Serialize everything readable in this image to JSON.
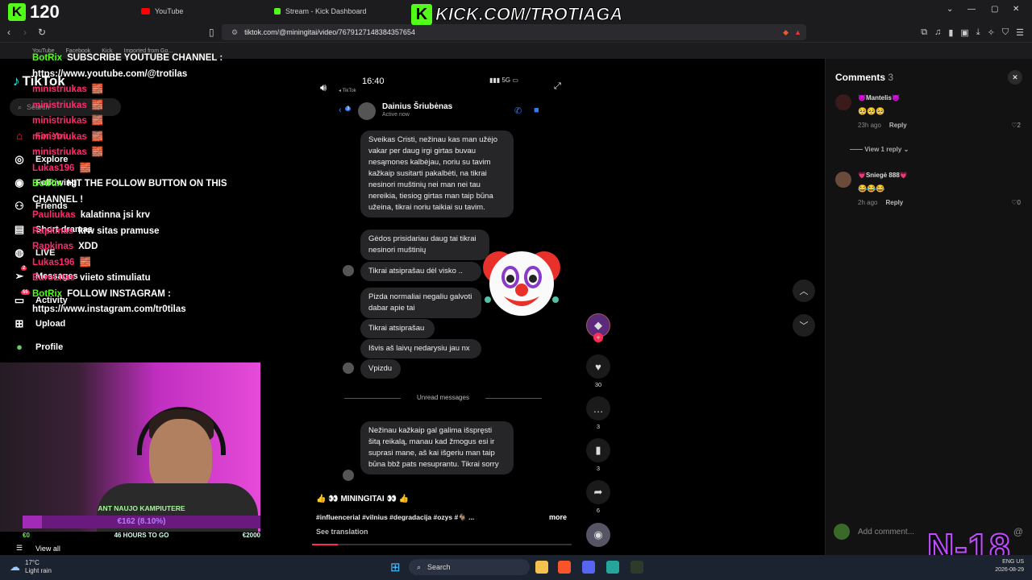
{
  "browser": {
    "tabs": [
      {
        "label": "YouTube",
        "color": "#ff0000"
      },
      {
        "label": "Stream - Kick Dashboard",
        "color": "#53fc18"
      }
    ],
    "url": "tiktok.com/@miningitai/video/7679127148384357654",
    "bookmarks": [
      "YouTube",
      "Facebook",
      "Kick",
      "Imported from Go..."
    ]
  },
  "tiktok": {
    "logo": "TikTok",
    "search_placeholder": "Search",
    "nav": [
      {
        "label": "For You",
        "icon": "home-icon"
      },
      {
        "label": "Explore",
        "icon": "compass-icon"
      },
      {
        "label": "Following",
        "icon": "following-icon"
      },
      {
        "label": "Friends",
        "icon": "friends-icon"
      },
      {
        "label": "Short dramas",
        "icon": "film-icon"
      },
      {
        "label": "LIVE",
        "icon": "live-icon"
      },
      {
        "label": "Messages",
        "icon": "send-icon",
        "badge": "2"
      },
      {
        "label": "Activity",
        "icon": "inbox-icon",
        "badge": "55"
      },
      {
        "label": "Upload",
        "icon": "plus-square-icon"
      },
      {
        "label": "Profile",
        "icon": "profile-icon"
      }
    ],
    "view_all": "View all"
  },
  "video": {
    "phone_time": "16:40",
    "phone_back": "◂ TikTok",
    "phone_status": "5G",
    "chat_contact": "Dainius Šriubėnas",
    "chat_status": "Active now",
    "back_count": "3",
    "messages": [
      "Sveikas Cristi, nežinau kas man užėjo vakar per daug irgi girtas buvau nesąmones kalbėjau, noriu su tavim kažkaip susitarti pakalbėti, na tikrai nesinori muštinių nei man nei tau nereikia, tiesiog girtas man taip būna užeina, tikrai noriu taikiai su tavim.",
      "Gėdos prisidariau daug tai tikrai nesinori muštinių",
      "Tikrai atsiprašau dėl visko ..",
      "Pizda normaliai negaliu galvoti dabar apie tai",
      "Tikrai atsiprašau",
      "Išvis aš laivų nedarysiu jau nx",
      "Vpizdu",
      "Nežinau kažkaip gal galima išspręsti šitą reikalą, manau kad žmogus esi ir suprasi mane, aš kai išgeriu man taip būna bbž pats nesuprantu. Tikrai sorry"
    ],
    "unread_label": "Unread messages",
    "caption_user": "👍 👀 MININGITAI 👀 👍",
    "caption_tags": "#influencerial #vilnius #degradacija #ozys #🐐 ...",
    "more": "more",
    "see_translation": "See translation",
    "progress": 0.1
  },
  "actions": {
    "likes": "30",
    "comments": "3",
    "saves": "3",
    "shares": "6"
  },
  "comments_panel": {
    "title": "Comments",
    "count": "3",
    "items": [
      {
        "name": "😈Mantelis😈",
        "emoji": "🥺🥺🥺",
        "time": "23h ago",
        "reply": "Reply",
        "likes": "2"
      },
      {
        "name": "💗Sniegė 888💗",
        "emoji": "😂😂😂",
        "time": "2h ago",
        "reply": "Reply",
        "likes": "0"
      }
    ],
    "view_replies": "View 1 reply",
    "add_comment": "Add comment..."
  },
  "stream_overlay": {
    "viewer_count": "120",
    "kick_url": "KICK.COM/TROTIAGA",
    "chat": [
      {
        "user": "BotRix",
        "color": "#53fc18",
        "text": "SUBSCRIBE YOUTUBE CHANNEL : https://www.youtube.com/@trotilas"
      },
      {
        "user": "ministriukas",
        "color": "#ff2a6d",
        "text": "🧱"
      },
      {
        "user": "ministriukas",
        "color": "#ff2a6d",
        "text": "🧱"
      },
      {
        "user": "ministriukas",
        "color": "#ff2a6d",
        "text": "🧱"
      },
      {
        "user": "ministriukas",
        "color": "#ff2a6d",
        "text": "🧱"
      },
      {
        "user": "ministriukas",
        "color": "#ff2a6d",
        "text": "🧱"
      },
      {
        "user": "Lukas196",
        "color": "#ff2a6d",
        "text": "🧱"
      },
      {
        "user": "BotRix",
        "color": "#53fc18",
        "text": "HIT THE FOLLOW BUTTON ON THIS CHANNEL !"
      },
      {
        "user": "Pauliukas",
        "color": "#ff2a6d",
        "text": "kalatinna jsi krv"
      },
      {
        "user": "Rapkinas",
        "color": "#ff2a6d",
        "text": "krw sitas pramuse"
      },
      {
        "user": "Rapkinas",
        "color": "#ff2a6d",
        "text": "XDD"
      },
      {
        "user": "Lukas196",
        "color": "#ff2a6d",
        "text": "🧱"
      },
      {
        "user": "EuroLitas",
        "color": "#ff2a6d",
        "text": "viieto stimuliatu"
      },
      {
        "user": "BotRix",
        "color": "#53fc18",
        "text": "FOLLOW INSTAGRAM : https://www.instagram.com/tr0tilas"
      }
    ],
    "goal_label": "ANT NAUJO KAMPIUTERE",
    "goal_value": "€162 (8.10%)",
    "goal_fraction": 0.081,
    "goal_start": "€0",
    "goal_remaining": "46 HOURS TO GO",
    "goal_target": "€2000",
    "age_rating": "N-18"
  },
  "taskbar": {
    "temp": "17°C",
    "weather": "Light rain",
    "search": "Search",
    "lang": "ENG US",
    "date": "2026-08-29"
  }
}
